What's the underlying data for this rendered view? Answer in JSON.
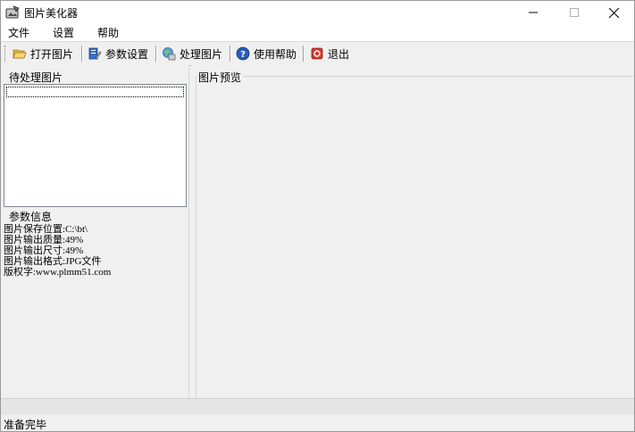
{
  "window": {
    "title": "图片美化器",
    "icon": "image-tool-icon"
  },
  "menu": {
    "items": [
      {
        "label": "文件"
      },
      {
        "label": "设置"
      },
      {
        "label": "帮助"
      }
    ]
  },
  "toolbar": {
    "buttons": [
      {
        "label": "打开图片",
        "icon": "folder-open-icon"
      },
      {
        "label": "参数设置",
        "icon": "settings-pencil-icon"
      },
      {
        "label": "处理图片",
        "icon": "process-image-icon"
      },
      {
        "label": "使用帮助",
        "icon": "help-icon"
      },
      {
        "label": "退出",
        "icon": "exit-icon"
      }
    ]
  },
  "left_panel": {
    "pending_title": "待处理图片",
    "params_title": "参数信息",
    "params": [
      "图片保存位置:C:\\bt\\",
      "图片输出质量:49%",
      "图片输出尺寸:49%",
      "图片输出格式:JPG文件",
      "版权字:www.plmm51.com"
    ]
  },
  "preview": {
    "title": "图片预览"
  },
  "status": {
    "text": "准备完毕"
  },
  "colors": {
    "help_icon": "#2b5db8",
    "exit_icon": "#d93a2b",
    "folder_icon": "#f2c14e"
  }
}
